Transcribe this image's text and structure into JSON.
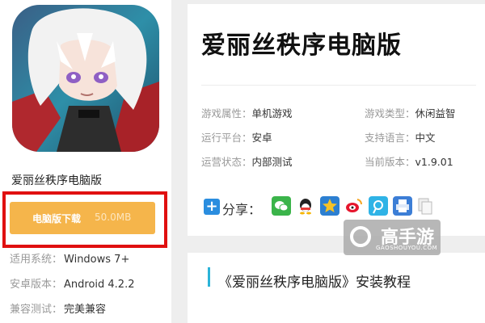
{
  "app": {
    "name": "爱丽丝秩序电脑版",
    "title": "爱丽丝秩序电脑版"
  },
  "download": {
    "label": "电脑版下载",
    "size": "50.0MB"
  },
  "specs": [
    {
      "key": "适用系统：",
      "value": "Windows 7+"
    },
    {
      "key": "安卓版本：",
      "value": "Android 4.2.2"
    },
    {
      "key": "兼容测试：",
      "value": "完美兼容"
    }
  ],
  "attributes": [
    {
      "key": "游戏属性：",
      "value": "单机游戏"
    },
    {
      "key": "游戏类型：",
      "value": "休闲益智"
    },
    {
      "key": "运行平台：",
      "value": "安卓"
    },
    {
      "key": "支持语言：",
      "value": "中文"
    },
    {
      "key": "运营状态：",
      "value": "内部测试"
    },
    {
      "key": "当前版本：",
      "value": "v1.9.01"
    }
  ],
  "share": {
    "label": "分享：",
    "icons": [
      "wechat-icon",
      "qq-icon",
      "qzone-icon",
      "weibo-icon",
      "tencent-weibo-icon",
      "print-icon",
      "copy-icon"
    ]
  },
  "tutorial": {
    "title": "《爱丽丝秩序电脑版》安装教程"
  },
  "watermark": {
    "brand": "高手游",
    "domain": "GAOSHOUYOU.COM"
  },
  "colors": {
    "download_button": "#f5b54b",
    "highlight_box": "#e01010",
    "accent": "#2bb3d8",
    "plus_button": "#2a8ddf"
  }
}
